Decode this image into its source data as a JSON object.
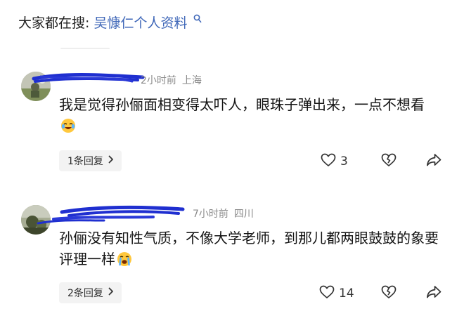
{
  "search_suggest": {
    "prefix": "大家都在搜:",
    "term": "吴慷仁个人资料",
    "icon": "search-icon"
  },
  "comments": [
    {
      "time": "2小时前",
      "location": "上海",
      "text": "我是觉得孙俪面相变得太吓人，眼珠子弹出来，一点不想看",
      "emoji": "crying-laughing-emoji",
      "replies_label": "1条回复",
      "likes": "3"
    },
    {
      "time": "7小时前",
      "location": "四川",
      "text": "孙俪没有知性气质，不像大学老师，到那儿都两眼鼓鼓的象要评理一样",
      "emoji": "crying-emoji",
      "replies_label": "2条回复",
      "likes": "14"
    }
  ],
  "colors": {
    "link_blue": "#3f67b8",
    "scribble_blue": "#1f2fd0",
    "meta_gray": "#8a8a8a",
    "pill_bg": "#f3f3f3"
  }
}
